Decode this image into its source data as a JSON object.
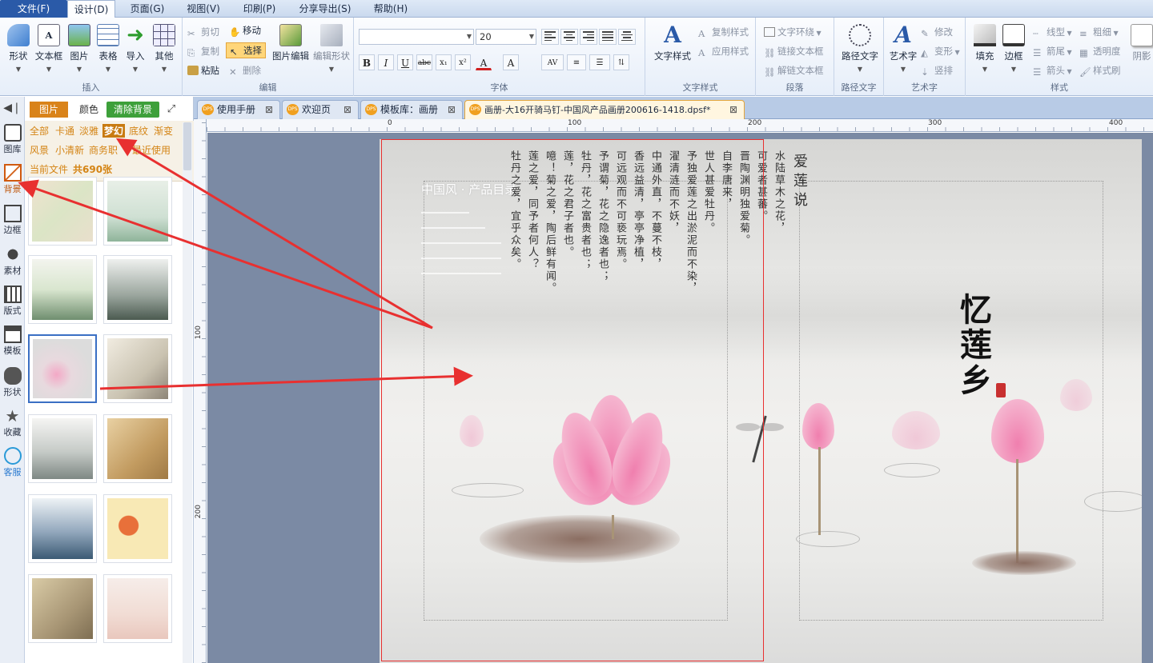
{
  "menubar": {
    "items": [
      "文件(F)",
      "设计(D)",
      "页面(G)",
      "视图(V)",
      "印刷(P)",
      "分享导出(S)",
      "帮助(H)"
    ],
    "active": "设计(D)"
  },
  "ribbon": {
    "insert": {
      "label": "插入",
      "buttons": [
        "形状",
        "文本框",
        "图片",
        "表格",
        "导入",
        "其他"
      ]
    },
    "edit": {
      "label": "编辑",
      "cut": "剪切",
      "copy": "复制",
      "paste": "粘贴",
      "move": "移动",
      "select": "选择",
      "delete": "删除",
      "image_edit": "图片编辑",
      "edit_shape": "编辑形状"
    },
    "font": {
      "label": "字体",
      "family_value": "",
      "size_value": "20",
      "buttons": [
        "B",
        "I",
        "U",
        "abc",
        "x₁",
        "x²",
        "A",
        "A"
      ]
    },
    "text_style": {
      "label": "文字样式",
      "main": "文字样式",
      "copy_style": "复制样式",
      "apply_style": "应用样式"
    },
    "paragraph": {
      "label": "段落",
      "wrap": "文字环绕",
      "link": "链接文本框",
      "unlink": "解链文本框"
    },
    "path_text": {
      "label": "路径文字",
      "main": "路径文字"
    },
    "art_text": {
      "label": "艺术字",
      "main": "艺术字",
      "modify": "修改",
      "transform": "变形",
      "vertical": "竖排"
    },
    "style": {
      "label": "样式",
      "fill": "填充",
      "border": "边框",
      "line_type": "线型",
      "line_end": "箭尾",
      "arrow_head": "箭头",
      "thickness": "粗细",
      "opacity": "透明度",
      "style_brush": "样式刷",
      "shadow": "阴影"
    }
  },
  "leftbar": {
    "items": [
      "图库",
      "背景",
      "边框",
      "素材",
      "版式",
      "模板",
      "形状",
      "收藏",
      "客服"
    ]
  },
  "panel": {
    "tabs": {
      "image": "图片",
      "color": "颜色",
      "clear": "清除背景"
    },
    "categories": [
      "全部",
      "卡通",
      "淡雅",
      "梦幻",
      "底纹",
      "渐变",
      "风景",
      "小清新",
      "商务职",
      "最近使用"
    ],
    "selected_category": "梦幻",
    "current_file_label": "当前文件",
    "count_label": "共690张"
  },
  "doctabs": [
    {
      "label": "使用手册",
      "active": false
    },
    {
      "label": "欢迎页",
      "active": false
    },
    {
      "label": "模板库：画册",
      "active": false
    },
    {
      "label": "画册-大16开骑马钉-中国风产品画册200616-1418.dpsf*",
      "active": true
    }
  ],
  "ruler": {
    "h_marks": [
      "0",
      "100",
      "200",
      "300",
      "400"
    ],
    "v_marks": [
      "100",
      "200"
    ]
  },
  "page": {
    "left": {
      "title": "中国风 · 产品目录",
      "poem_columns": [
        "水陆草木之花，",
        "可爱者甚蕃。",
        "晋陶渊明独爱菊。",
        "自李唐来，",
        "世人甚爱牡丹。",
        "予独爱莲之出淤泥而不染，",
        "濯清涟而不妖，",
        "中通外直，不蔓不枝，",
        "香远益清，亭亭净植，",
        "可远观而不可亵玩焉。",
        "予谓菊，花之隐逸者也；",
        "牡丹，花之富贵者也；",
        "莲，花之君子者也。",
        "噫！菊之爱，陶后鲜有闻。",
        "莲之爱，同予者何人？",
        "牡丹之爱，宜乎众矣。"
      ],
      "poem_title": "爱莲说"
    },
    "right": {
      "brand": "忆莲乡"
    }
  },
  "colors": {
    "accent": "#e83030",
    "ribbon_bg": "#e6eef9",
    "file_menu": "#2a5aa8",
    "category_active": "#c87a10",
    "clear_button": "#3da03a"
  }
}
